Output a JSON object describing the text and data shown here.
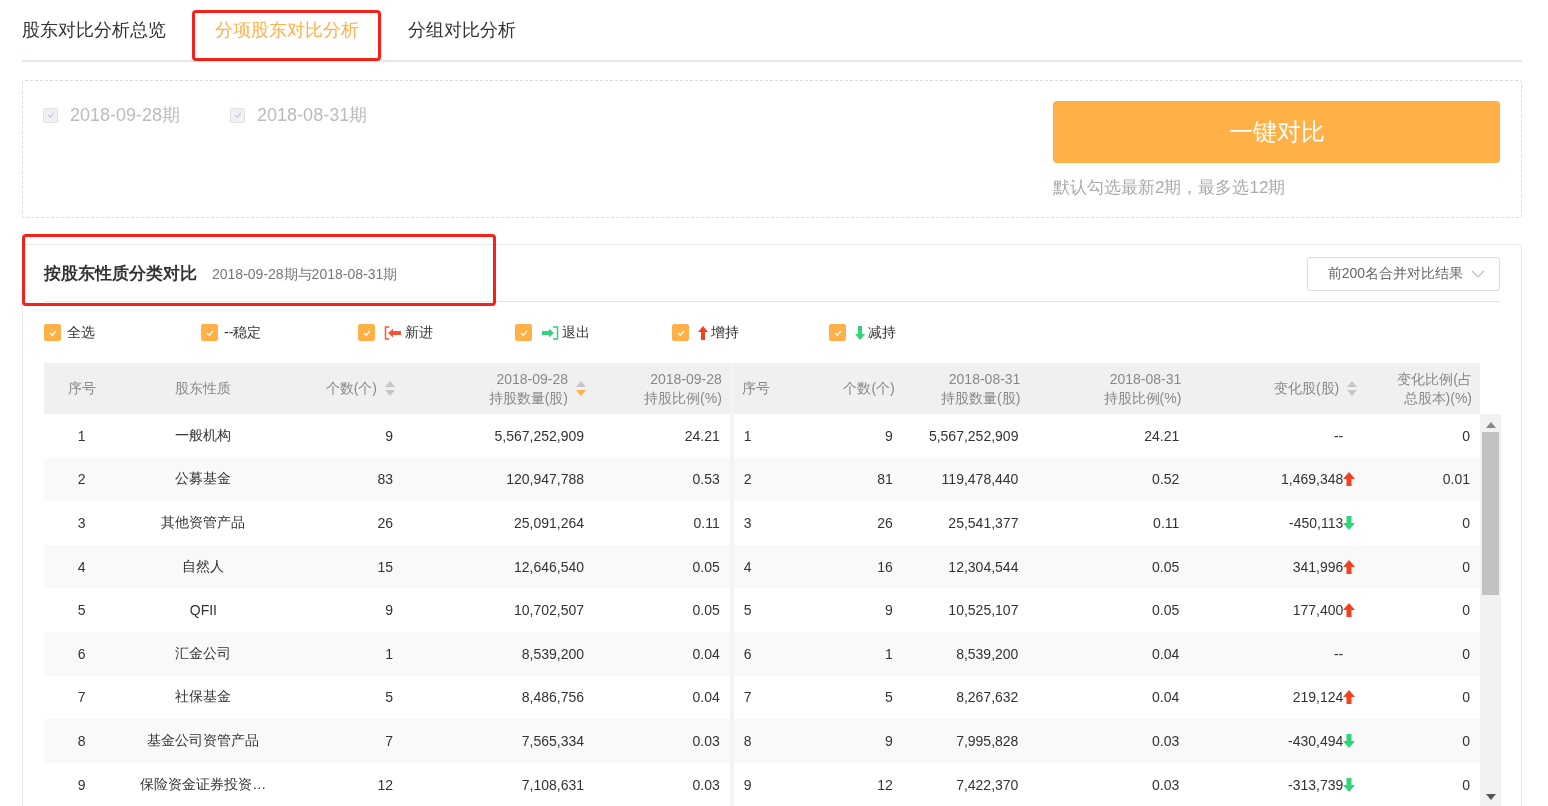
{
  "tabs": [
    {
      "label": "股东对比分析总览",
      "selected": false
    },
    {
      "label": "分项股东对比分析",
      "selected": true
    },
    {
      "label": "分组对比分析",
      "selected": false
    }
  ],
  "periods": [
    {
      "label": "2018-09-28期",
      "checked": true,
      "disabled": true
    },
    {
      "label": "2018-08-31期",
      "checked": true,
      "disabled": true
    }
  ],
  "compare_button": {
    "label": "一键对比"
  },
  "hint": "默认勾选最新2期，最多选12期",
  "section": {
    "title": "按股东性质分类对比",
    "subtitle": "2018-09-28期与2018-08-31期",
    "dropdown": "前200名合并对比结果"
  },
  "filters": [
    {
      "kind": "all",
      "label": "全选",
      "checked": true
    },
    {
      "kind": "stable",
      "label": "--稳定",
      "checked": true
    },
    {
      "kind": "new",
      "label": "新进",
      "checked": true
    },
    {
      "kind": "exit",
      "label": "退出",
      "checked": true
    },
    {
      "kind": "increase",
      "label": "增持",
      "checked": true
    },
    {
      "kind": "decrease",
      "label": "减持",
      "checked": true
    }
  ],
  "table": {
    "columns": [
      {
        "lines": [
          "序号"
        ]
      },
      {
        "lines": [
          "股东性质"
        ]
      },
      {
        "lines": [
          "个数(个)"
        ],
        "sorted": false
      },
      {
        "lines": [
          "2018-09-28",
          "持股数量(股)"
        ],
        "sorted": true
      },
      {
        "lines": [
          "2018-09-28",
          "持股比例(%)"
        ]
      },
      {
        "lines": [
          "序号"
        ]
      },
      {
        "lines": [
          "个数(个)"
        ]
      },
      {
        "lines": [
          "2018-08-31",
          "持股数量(股)"
        ]
      },
      {
        "lines": [
          "2018-08-31",
          "持股比例(%)"
        ]
      },
      {
        "lines": [
          "变化股(股)"
        ],
        "sorted": false
      },
      {
        "lines": [
          "变化比例(占",
          "总股本)(%)"
        ]
      }
    ],
    "rows": [
      {
        "cells": [
          "1",
          "一般机构",
          "9",
          "5,567,252,909",
          "24.21",
          "1",
          "9",
          "5,567,252,909",
          "24.21",
          "--",
          "0"
        ],
        "kind": "flat"
      },
      {
        "cells": [
          "2",
          "公募基金",
          "83",
          "120,947,788",
          "0.53",
          "2",
          "81",
          "119,478,440",
          "0.52",
          "1,469,348",
          "0.01"
        ],
        "kind": "up"
      },
      {
        "cells": [
          "3",
          "其他资管产品",
          "26",
          "25,091,264",
          "0.11",
          "3",
          "26",
          "25,541,377",
          "0.11",
          "-450,113",
          "0"
        ],
        "kind": "down"
      },
      {
        "cells": [
          "4",
          "自然人",
          "15",
          "12,646,540",
          "0.05",
          "4",
          "16",
          "12,304,544",
          "0.05",
          "341,996",
          "0"
        ],
        "kind": "up"
      },
      {
        "cells": [
          "5",
          "QFII",
          "9",
          "10,702,507",
          "0.05",
          "5",
          "9",
          "10,525,107",
          "0.05",
          "177,400",
          "0"
        ],
        "kind": "up"
      },
      {
        "cells": [
          "6",
          "汇金公司",
          "1",
          "8,539,200",
          "0.04",
          "6",
          "1",
          "8,539,200",
          "0.04",
          "--",
          "0"
        ],
        "kind": "flat"
      },
      {
        "cells": [
          "7",
          "社保基金",
          "5",
          "8,486,756",
          "0.04",
          "7",
          "5",
          "8,267,632",
          "0.04",
          "219,124",
          "0"
        ],
        "kind": "up"
      },
      {
        "cells": [
          "8",
          "基金公司资管产品",
          "7",
          "7,565,334",
          "0.03",
          "8",
          "9",
          "7,995,828",
          "0.03",
          "-430,494",
          "0"
        ],
        "kind": "down"
      },
      {
        "cells": [
          "9",
          "保险资金证券投资…",
          "12",
          "7,108,631",
          "0.03",
          "9",
          "12",
          "7,422,370",
          "0.03",
          "-313,739",
          "0"
        ],
        "kind": "down"
      }
    ]
  }
}
